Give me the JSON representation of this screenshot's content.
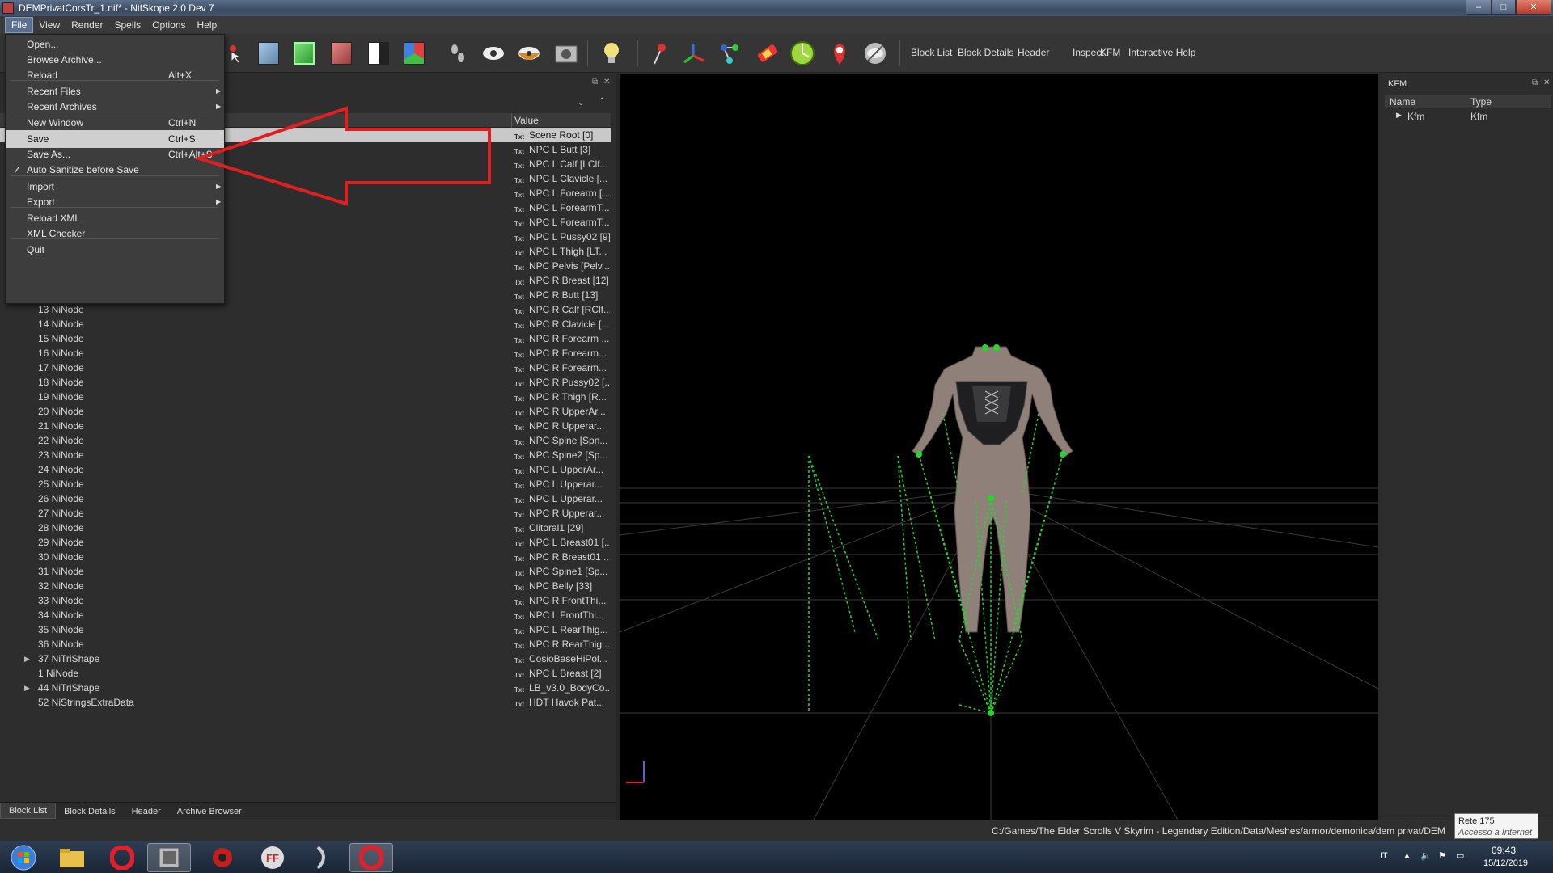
{
  "window": {
    "title": "DEMPrivatCorsTr_1.nif* - NifSkope 2.0 Dev 7",
    "controls": {
      "minimize": "–",
      "maximize": "□",
      "close": "✕"
    }
  },
  "menubar": [
    "File",
    "View",
    "Render",
    "Spells",
    "Options",
    "Help"
  ],
  "file_menu": {
    "items": [
      {
        "label": "Open...",
        "shortcut": ""
      },
      {
        "label": "Browse Archive...",
        "shortcut": ""
      },
      {
        "label": "Reload",
        "shortcut": "Alt+X"
      },
      {
        "label": "Recent Files",
        "shortcut": "",
        "submenu": true
      },
      {
        "label": "Recent Archives",
        "shortcut": "",
        "submenu": true
      },
      {
        "label": "New Window",
        "shortcut": "Ctrl+N"
      },
      {
        "label": "Save",
        "shortcut": "Ctrl+S",
        "highlighted": true
      },
      {
        "label": "Save As...",
        "shortcut": "Ctrl+Alt+S"
      },
      {
        "label": "Auto Sanitize before Save",
        "shortcut": "",
        "checked": true
      },
      {
        "label": "Import",
        "shortcut": "",
        "submenu": true
      },
      {
        "label": "Export",
        "shortcut": "",
        "submenu": true
      },
      {
        "label": "Reload XML",
        "shortcut": ""
      },
      {
        "label": "XML Checker",
        "shortcut": ""
      },
      {
        "label": "Quit",
        "shortcut": ""
      }
    ],
    "check_mark": "✓",
    "submenu_arrow": "▶"
  },
  "toolbar": {
    "text_buttons": [
      "Block List",
      "Block Details",
      "Header",
      "Inspect",
      "KFM",
      "Interactive Help"
    ],
    "icons": [
      "select-cursor-icon",
      "blue-cube-icon",
      "green-cube-icon",
      "red-cube-icon",
      "half-cube-icon",
      "colored-cube-icon",
      "footprints-icon",
      "eye-icon",
      "eye-half-icon",
      "camera-icon",
      "lightbulb-icon",
      "pin-icon",
      "axes-icon",
      "nodes-icon",
      "gradient-icon",
      "clock-icon",
      "marker-icon",
      "eye-hidden-icon"
    ]
  },
  "block_list": {
    "value_header": "Value",
    "txt_badge": "Txt",
    "rows": [
      {
        "name": "",
        "value": "Scene Root [0]",
        "selected": true
      },
      {
        "name": "",
        "value": "NPC L Butt [3]"
      },
      {
        "name": "",
        "value": "NPC L Calf [LClf..."
      },
      {
        "name": "",
        "value": "NPC L Clavicle [..."
      },
      {
        "name": "",
        "value": "NPC L Forearm [..."
      },
      {
        "name": "",
        "value": "NPC L ForearmT..."
      },
      {
        "name": "",
        "value": "NPC L ForearmT..."
      },
      {
        "name": "",
        "value": "NPC L Pussy02 [9]"
      },
      {
        "name": "",
        "value": "NPC L Thigh [LT..."
      },
      {
        "name": "",
        "value": "NPC Pelvis [Pelv..."
      },
      {
        "name": "",
        "value": "NPC R Breast [12]"
      },
      {
        "name": "",
        "value": "NPC R Butt [13]"
      },
      {
        "name": "13 NiNode",
        "value": "NPC R Calf [RClf..."
      },
      {
        "name": "14 NiNode",
        "value": "NPC R Clavicle [..."
      },
      {
        "name": "15 NiNode",
        "value": "NPC R Forearm ..."
      },
      {
        "name": "16 NiNode",
        "value": "NPC R Forearm..."
      },
      {
        "name": "17 NiNode",
        "value": "NPC R Forearm..."
      },
      {
        "name": "18 NiNode",
        "value": "NPC R Pussy02 [..."
      },
      {
        "name": "19 NiNode",
        "value": "NPC R Thigh [R..."
      },
      {
        "name": "20 NiNode",
        "value": "NPC R UpperAr..."
      },
      {
        "name": "21 NiNode",
        "value": "NPC R Upperar..."
      },
      {
        "name": "22 NiNode",
        "value": "NPC Spine [Spn..."
      },
      {
        "name": "23 NiNode",
        "value": "NPC Spine2 [Sp..."
      },
      {
        "name": "24 NiNode",
        "value": "NPC L UpperAr..."
      },
      {
        "name": "25 NiNode",
        "value": "NPC L Upperar..."
      },
      {
        "name": "26 NiNode",
        "value": "NPC L Upperar..."
      },
      {
        "name": "27 NiNode",
        "value": "NPC R Upperar..."
      },
      {
        "name": "28 NiNode",
        "value": "Clitoral1 [29]"
      },
      {
        "name": "29 NiNode",
        "value": "NPC L Breast01 [..."
      },
      {
        "name": "30 NiNode",
        "value": "NPC R Breast01 ..."
      },
      {
        "name": "31 NiNode",
        "value": "NPC Spine1 [Sp..."
      },
      {
        "name": "32 NiNode",
        "value": "NPC Belly [33]"
      },
      {
        "name": "33 NiNode",
        "value": "NPC R FrontThi..."
      },
      {
        "name": "34 NiNode",
        "value": "NPC L FrontThi..."
      },
      {
        "name": "35 NiNode",
        "value": "NPC L RearThig..."
      },
      {
        "name": "36 NiNode",
        "value": "NPC R RearThig..."
      },
      {
        "name": "37 NiTriShape",
        "value": "CosioBaseHiPol...",
        "expandable": true
      },
      {
        "name": "1 NiNode",
        "value": "NPC L Breast [2]"
      },
      {
        "name": "44 NiTriShape",
        "value": "LB_v3.0_BodyCo...",
        "expandable": true
      },
      {
        "name": "52 NiStringsExtraData",
        "value": "HDT Havok Pat..."
      }
    ],
    "expander_glyph": "▶"
  },
  "bottom_tabs": [
    "Block List",
    "Block Details",
    "Header",
    "Archive Browser"
  ],
  "kfm_panel": {
    "title": "KFM",
    "headers": {
      "name": "Name",
      "type": "Type"
    },
    "rows": [
      {
        "name": "Kfm",
        "type": "Kfm"
      }
    ]
  },
  "statusbar": {
    "path": "C:/Games/The Elder Scrolls V Skyrim - Legendary Edition/Data/Meshes/armor/demonica/dem privat/DEM"
  },
  "network_tooltip": {
    "line1": "Rete 175",
    "line2": "Accesso a Internet"
  },
  "taskbar": {
    "language": "IT",
    "time": "09:43",
    "date": "15/12/2019"
  },
  "colors": {
    "skeleton_green": "#22d82a",
    "annotation_red": "#e02020",
    "body_skin": "#8f8079"
  }
}
